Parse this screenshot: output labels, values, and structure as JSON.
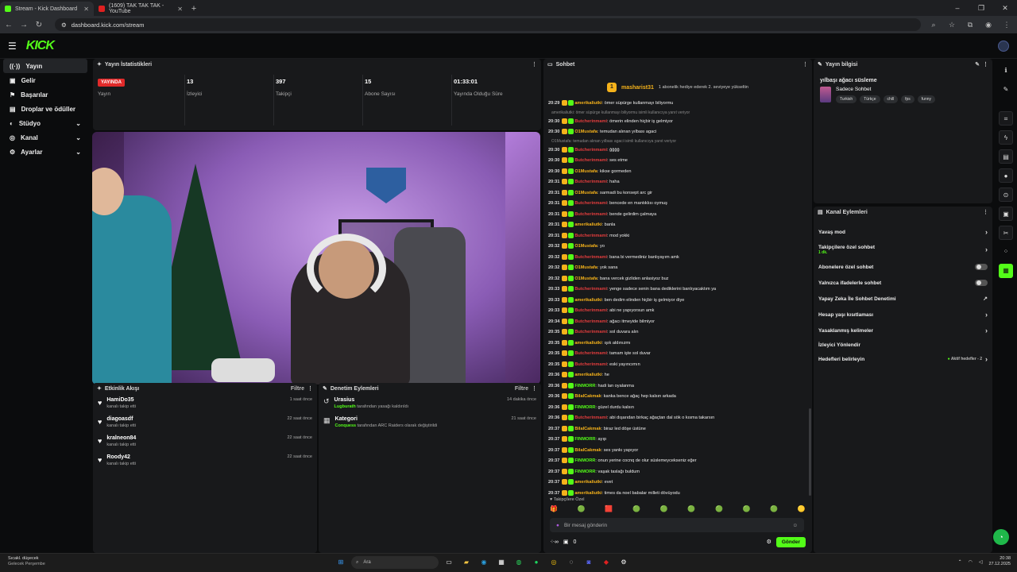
{
  "browser": {
    "tabs": [
      {
        "title": "Stream - Kick Dashboard",
        "active": true
      },
      {
        "title": "(1609) TAK TAK TAK - YouTube",
        "active": false
      }
    ],
    "url": "dashboard.kick.com/stream"
  },
  "app": {
    "logo": "KICK"
  },
  "sidebar": {
    "items": [
      {
        "label": "Yayın",
        "icon": "broadcast-icon"
      },
      {
        "label": "Gelir",
        "icon": "wallet-icon"
      },
      {
        "label": "Başarılar",
        "icon": "flag-icon"
      },
      {
        "label": "Droplar ve ödüller",
        "icon": "gift-icon"
      },
      {
        "label": "Stüdyo",
        "icon": "palette-icon"
      },
      {
        "label": "Kanal",
        "icon": "user-icon"
      },
      {
        "label": "Ayarlar",
        "icon": "gear-icon"
      }
    ]
  },
  "stats": {
    "title": "Yayın İstatistikleri",
    "items": [
      {
        "value": "YAYINDA",
        "label": "Yayın"
      },
      {
        "value": "13",
        "label": "İzleyici"
      },
      {
        "value": "397",
        "label": "Takipçi"
      },
      {
        "value": "15",
        "label": "Abone Sayısı"
      },
      {
        "value": "01:33:01",
        "label": "Yayında Olduğu Süre"
      }
    ]
  },
  "activity": {
    "title": "Etkinlik Akışı",
    "filter": "Filtre",
    "items": [
      {
        "name": "HamiDo35",
        "sub": "kanalı takip etti",
        "time": "1 saat önce"
      },
      {
        "name": "diagoasdf",
        "sub": "kanalı takip etti",
        "time": "22 saat önce"
      },
      {
        "name": "kralneon84",
        "sub": "kanalı takip etti",
        "time": "22 saat önce"
      },
      {
        "name": "Roody42",
        "sub": "kanalı takip etti",
        "time": "22 saat önce"
      }
    ]
  },
  "moderation": {
    "title": "Denetim Eylemleri",
    "filter": "Filtre",
    "items": [
      {
        "name": "Urasius",
        "actor": "Lugburath",
        "text": "tarafından yasağı kaldırıldı",
        "time": "14 dakika önce"
      },
      {
        "name": "Kategori",
        "actor": "Conquess",
        "text": "tarafından ARC Raiders olarak değiştirildi",
        "time": "21 saat önce"
      }
    ]
  },
  "chat": {
    "title": "Sohbet",
    "gift_user": "masharist31",
    "gift_count": "1",
    "gift_message": "1 abonelik hediye ederek 2. seviyeye yükseltin",
    "messages": [
      {
        "time": "20:29",
        "user": "amerikaliutki",
        "color": "#f5b21b",
        "text": "ömer süpürge kullanmayı biliyormu"
      },
      {
        "reply": "amerikaliutki: ömer süpürge kullanmayı biliyormu isimli kullanıcıya yanıt veriyor"
      },
      {
        "time": "20:30",
        "user": "Butcherinmami",
        "color": "#e33d3d",
        "text": "ömerin elinden hiçbir iş gelmiyor"
      },
      {
        "time": "20:30",
        "user": "O1Mustafa",
        "color": "#f5b21b",
        "text": "temudan alınan yılbası agaci"
      },
      {
        "reply": "O1Mustafa: temudan alınan yılbası agaci isimli kullanıcıya yanıt veriyor"
      },
      {
        "time": "20:30",
        "user": "Butcherinmami",
        "color": "#e33d3d",
        "text": "ğğğğ"
      },
      {
        "time": "20:30",
        "user": "Butcherinmami",
        "color": "#e33d3d",
        "text": "ses etme"
      },
      {
        "time": "20:30",
        "user": "O1Mustafa",
        "color": "#f5b21b",
        "text": "kikse gormeden"
      },
      {
        "time": "20:31",
        "user": "Butcherinmami",
        "color": "#e33d3d",
        "text": "haha"
      },
      {
        "time": "20:31",
        "user": "O1Mustafa",
        "color": "#f5b21b",
        "text": "sarmadi bu konsept arc gir"
      },
      {
        "time": "20:31",
        "user": "Butcherinmami",
        "color": "#e33d3d",
        "text": "bencede en mantıklısı oymuş"
      },
      {
        "time": "20:31",
        "user": "Butcherinmami",
        "color": "#e33d3d",
        "text": "bende gelirdim çalmaya"
      },
      {
        "time": "20:31",
        "user": "amerikaliutki",
        "color": "#f5b21b",
        "text": "banla"
      },
      {
        "time": "20:31",
        "user": "Butcherinmami",
        "color": "#e33d3d",
        "text": "mod yokki"
      },
      {
        "time": "20:32",
        "user": "O1Mustafa",
        "color": "#f5b21b",
        "text": "yo"
      },
      {
        "time": "20:32",
        "user": "Butcherinmami",
        "color": "#e33d3d",
        "text": "bana bi vermediniz banlıyayım amk"
      },
      {
        "time": "20:32",
        "user": "O1Mustafa",
        "color": "#f5b21b",
        "text": "yok sana"
      },
      {
        "time": "20:32",
        "user": "O1Mustafa",
        "color": "#f5b21b",
        "text": "bana vercek gizliden anlasiyoz buz"
      },
      {
        "time": "20:33",
        "user": "Butcherinmami",
        "color": "#e33d3d",
        "text": "yenge sadece senin bana dediklerini banlıyacaktım ya"
      },
      {
        "time": "20:33",
        "user": "amerikaliutki",
        "color": "#f5b21b",
        "text": "ben dedim elinden hiçbir iş gelmiyor diye"
      },
      {
        "time": "20:33",
        "user": "Butcherinmami",
        "color": "#e33d3d",
        "text": "abi ne yapıyorsun amk"
      },
      {
        "time": "20:34",
        "user": "Butcherinmami",
        "color": "#e33d3d",
        "text": "ağacı itmeyide bilmiyor"
      },
      {
        "time": "20:35",
        "user": "Butcherinmami",
        "color": "#e33d3d",
        "text": "sol duvara alın"
      },
      {
        "time": "20:35",
        "user": "amerikaliutki",
        "color": "#f5b21b",
        "text": "ışık aldınızmı"
      },
      {
        "time": "20:35",
        "user": "Butcherinmami",
        "color": "#e33d3d",
        "text": "tamam işte sol duvar"
      },
      {
        "time": "20:35",
        "user": "Butcherinmami",
        "color": "#e33d3d",
        "text": "eski yayıncımın"
      },
      {
        "time": "20:36",
        "user": "amerikaliutki",
        "color": "#f5b21b",
        "text": "he"
      },
      {
        "time": "20:36",
        "user": "FINMORR",
        "color": "#53fc18",
        "text": "hadi lan oyalanma"
      },
      {
        "time": "20:36",
        "user": "BilalCakmak",
        "color": "#f5b21b",
        "text": "kanka bence ağaç hep kalsın arkada"
      },
      {
        "time": "20:36",
        "user": "FINMORR",
        "color": "#53fc18",
        "text": "güzel durdu kalsın"
      },
      {
        "time": "20:36",
        "user": "Butcherinmami",
        "color": "#e33d3d",
        "text": "abi dışarıdan birkaç ağaçtan dal sök o kısma takarsın"
      },
      {
        "time": "20:37",
        "user": "BilalCakmak",
        "color": "#f5b21b",
        "text": "biraz led döşe üstüne"
      },
      {
        "time": "20:37",
        "user": "FINMORR",
        "color": "#53fc18",
        "text": "ayıp"
      },
      {
        "time": "20:37",
        "user": "BilalCakmak",
        "color": "#f5b21b",
        "text": "ses yankı yapıyor"
      },
      {
        "time": "20:37",
        "user": "FINMORR",
        "color": "#53fc18",
        "text": "onun yerine cocnq de olur süslemeycekseniz eğer"
      },
      {
        "time": "20:37",
        "user": "FINMORR",
        "color": "#53fc18",
        "text": "vaşak taslağı buldum"
      },
      {
        "time": "20:37",
        "user": "amerikaliutki",
        "color": "#f5b21b",
        "text": "evet"
      },
      {
        "time": "20:37",
        "user": "amerikaliutki",
        "color": "#f5b21b",
        "text": "times da noel babalar milleti dövüyodu"
      }
    ],
    "pinned_mode": "Takipçilere Özel",
    "input_placeholder": "Bir mesaj gönderin",
    "count_value": "0",
    "send_label": "Gönder"
  },
  "stream_info": {
    "title": "Yayın bilgisi",
    "stream_title": "yılbaşı ağacı süsleme",
    "category": "Sadece Sohbet",
    "tags": [
      "Turkish",
      "Türkçe",
      "chill",
      "fps",
      "funny"
    ]
  },
  "channel_actions": {
    "title": "Kanal Eylemleri",
    "items": [
      {
        "label": "Yavaş mod",
        "control": "chevron"
      },
      {
        "label": "Takipçilere özel sohbet",
        "sub": "1 dk.",
        "control": "chevron"
      },
      {
        "label": "Abonelere özel sohbet",
        "control": "toggle"
      },
      {
        "label": "Yalnızca ifadelerle sohbet",
        "control": "toggle"
      },
      {
        "label": "Yapay Zeka İle Sohbet Denetimi",
        "control": "external"
      },
      {
        "label": "Hesap yaşı kısıtlaması",
        "control": "chevron"
      },
      {
        "label": "Yasaklanmış kelimeler",
        "control": "chevron"
      },
      {
        "label": "İzleyici Yönlendir",
        "control": "none"
      },
      {
        "label": "Hedefleri belirleyin",
        "control": "goal",
        "extra": "Aktif hedefler - 2"
      }
    ]
  },
  "taskbar": {
    "weather_title": "Sıcakl. düşecek",
    "weather_sub": "Gelecek Perşembe",
    "search": "Ara",
    "time": "20:38",
    "date": "27.12.2025"
  }
}
